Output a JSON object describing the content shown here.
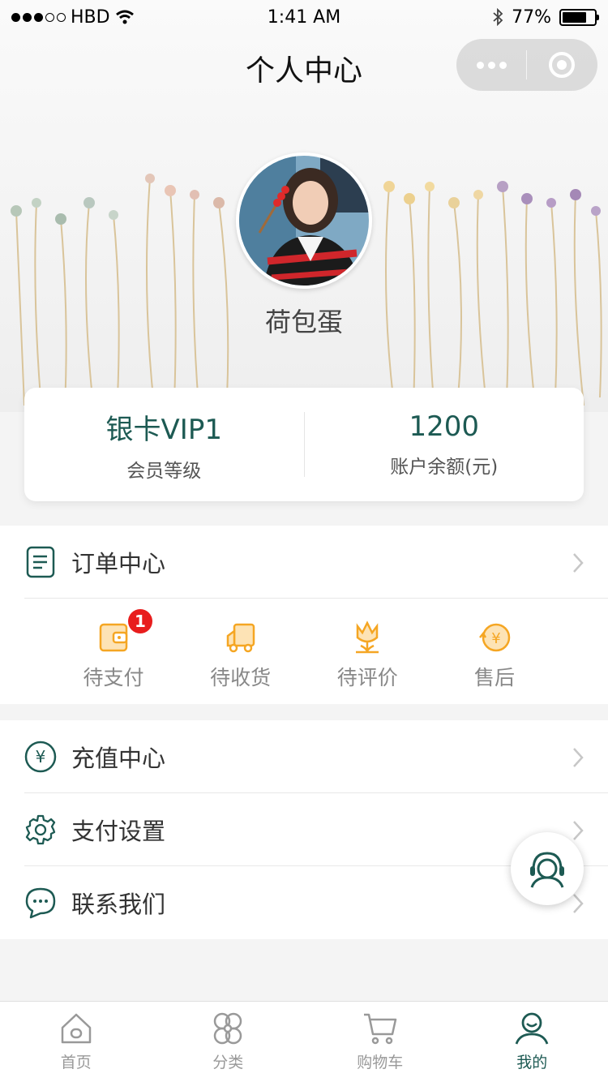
{
  "status": {
    "carrier": "HBD",
    "time": "1:41 AM",
    "battery": "77%"
  },
  "nav": {
    "title": "个人中心"
  },
  "profile": {
    "name": "荷包蛋"
  },
  "stats": {
    "level_value": "银卡VIP1",
    "level_label": "会员等级",
    "balance_value": "1200",
    "balance_label": "账户余额(元)"
  },
  "orders": {
    "title": "订单中心",
    "items": [
      {
        "label": "待支付",
        "badge": "1",
        "icon": "wallet-icon"
      },
      {
        "label": "待收货",
        "icon": "truck-icon"
      },
      {
        "label": "待评价",
        "icon": "flower-icon"
      },
      {
        "label": "售后",
        "icon": "yen-refund-icon"
      }
    ]
  },
  "menu": [
    {
      "label": "充值中心",
      "icon": "yen-circle-icon"
    },
    {
      "label": "支付设置",
      "icon": "gear-icon"
    },
    {
      "label": "联系我们",
      "icon": "chat-icon"
    }
  ],
  "tabbar": [
    {
      "label": "首页",
      "icon": "home-icon"
    },
    {
      "label": "分类",
      "icon": "category-icon"
    },
    {
      "label": "购物车",
      "icon": "cart-icon"
    },
    {
      "label": "我的",
      "icon": "profile-icon",
      "active": true
    }
  ],
  "colors": {
    "accent": "#1d5a53",
    "order_icon": "#f5a623",
    "badge": "#e81d1d"
  }
}
